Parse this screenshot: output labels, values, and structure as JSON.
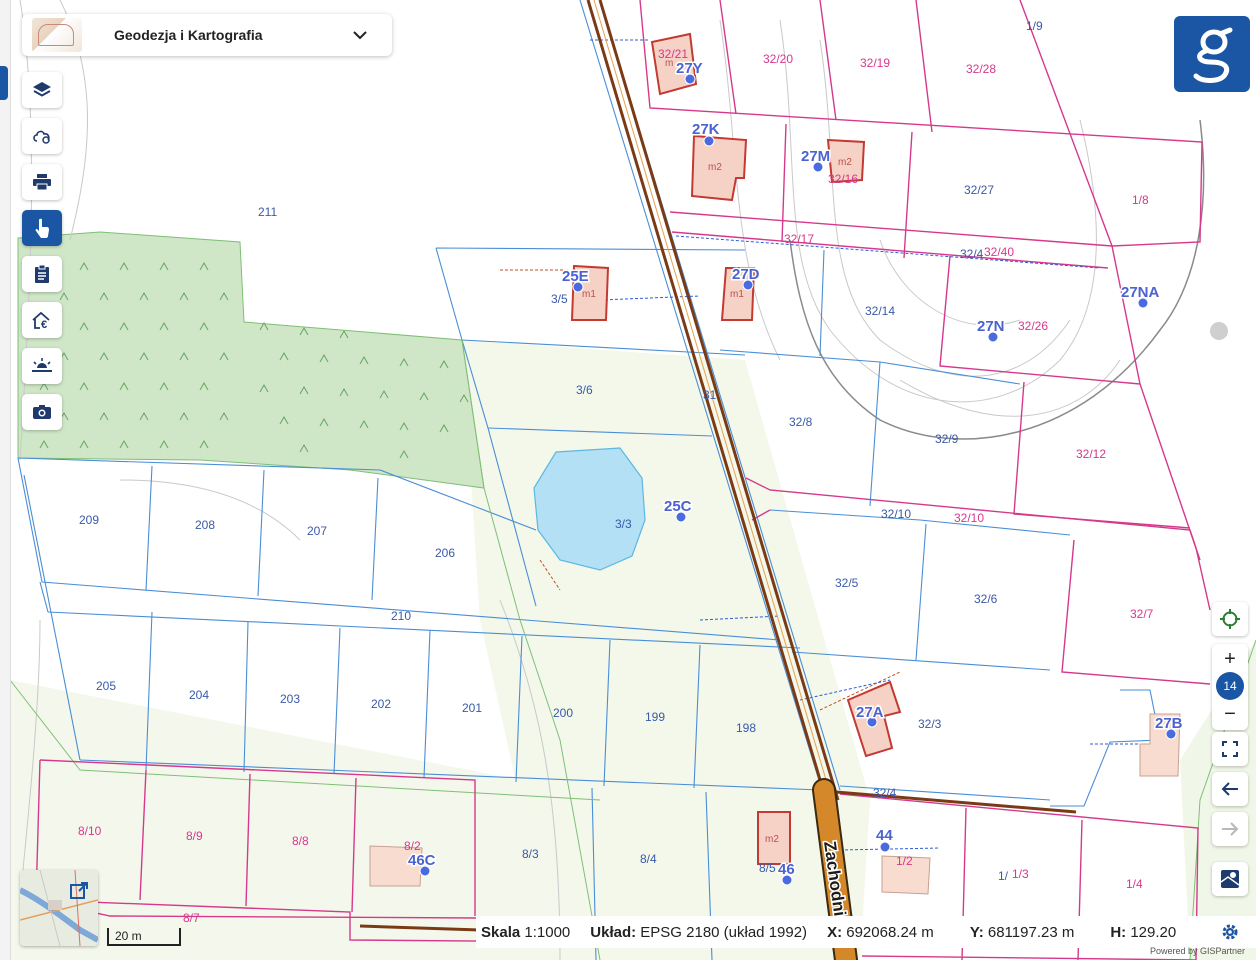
{
  "layer_selector": {
    "title": "Geodezja i Kartografia",
    "chevron_icon": "chevron-down-icon"
  },
  "left_toolbar": [
    {
      "name": "layers-button",
      "icon": "layers-icon",
      "active": false
    },
    {
      "name": "cloud-button",
      "icon": "cloud-icon",
      "active": false
    },
    {
      "name": "print-button",
      "icon": "printer-icon",
      "active": false
    },
    {
      "name": "identify-button",
      "icon": "pointer-hand-icon",
      "active": true
    },
    {
      "name": "report-button",
      "icon": "clipboard-icon",
      "active": false
    },
    {
      "name": "property-price-button",
      "icon": "house-euro-icon",
      "active": false
    },
    {
      "name": "sun-position-button",
      "icon": "sunset-icon",
      "active": false
    },
    {
      "name": "screenshot-button",
      "icon": "camera-icon",
      "active": false
    }
  ],
  "logo": {
    "letter": "g",
    "color": "#1b56a5"
  },
  "right_controls": {
    "zoom_level": "14",
    "zoom_in": "+",
    "zoom_out": "−"
  },
  "scale_bar": {
    "label": "20 m"
  },
  "status_bar": {
    "scale_key": "Skala",
    "scale_value": "1:1000",
    "crs_key": "Układ:",
    "crs_value": "EPSG 2180 (układ 1992)",
    "x_key": "X:",
    "x_value": "692068.24 m",
    "y_key": "Y:",
    "y_value": "681197.23 m",
    "h_key": "H:",
    "h_value": "129.20"
  },
  "powered_by": "Powered by GISPartner",
  "map_labels": {
    "parcels_blue": [
      "211",
      "3/5",
      "3/6",
      "31",
      "3/3",
      "209",
      "208",
      "207",
      "206",
      "210",
      "205",
      "204",
      "203",
      "202",
      "201",
      "200",
      "199",
      "198",
      "8/3",
      "8/4",
      "8/5",
      "32/27",
      "32/14",
      "32/8",
      "32/9",
      "32/5",
      "32/6",
      "32/3",
      "32/4",
      "32/10",
      "1/9",
      "1/"
    ],
    "parcels_pink": [
      "32/21",
      "32/20",
      "32/19",
      "32/28",
      "32/16",
      "1/8",
      "32/17",
      "32/40",
      "32/26",
      "32/12",
      "32/10",
      "32/7",
      "8/10",
      "8/9",
      "8/8",
      "8/2",
      "8/7",
      "1/2",
      "1/3",
      "1/4"
    ],
    "addresses": [
      "27Y",
      "27K",
      "27M",
      "25E",
      "27D",
      "27NA",
      "27N",
      "25C",
      "27A",
      "27B",
      "46C",
      "46",
      "44"
    ],
    "buildings": [
      "m",
      "m2",
      "m2",
      "m1",
      "m1",
      "m2"
    ],
    "street": "Zachodnia"
  },
  "colors": {
    "accent": "#1b56a5",
    "parcel_blue": "#4a8ed6",
    "parcel_pink": "#d6398c",
    "forest": "#cfe6c7",
    "road": "#7b3a16"
  }
}
